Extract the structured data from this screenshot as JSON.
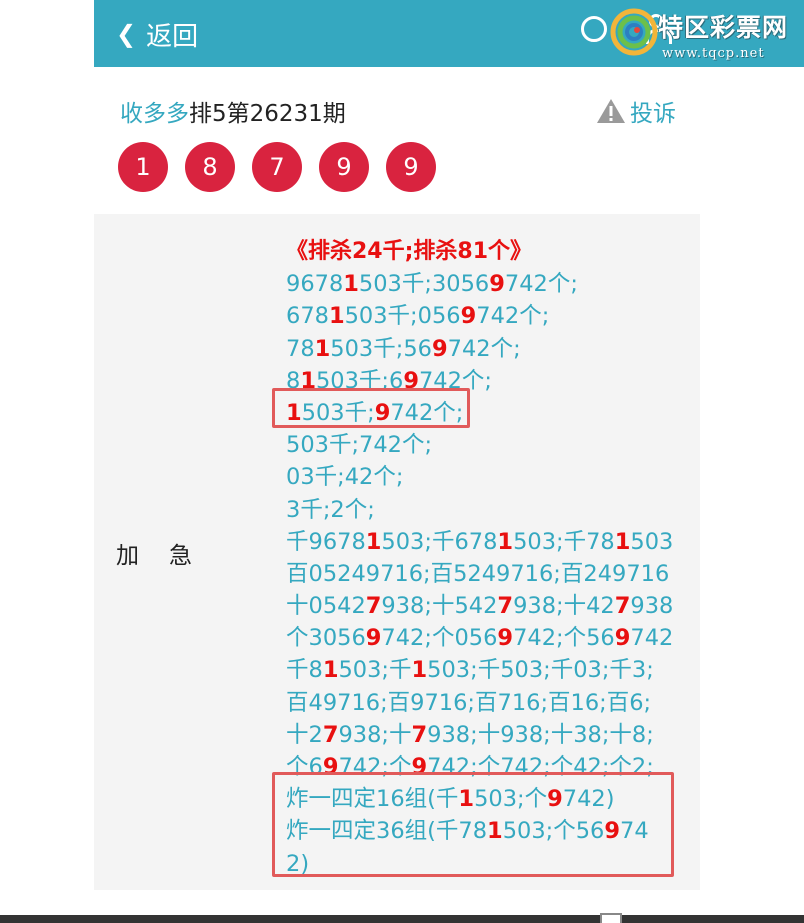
{
  "header": {
    "back_label": "返回",
    "watermark_title": "特区彩票网",
    "watermark_url": "www.tqcp.net",
    "bg_color": "#35a8c0"
  },
  "title": {
    "author": "收多多",
    "issue": "排5第26231期",
    "complain_label": "投诉"
  },
  "balls": [
    "1",
    "8",
    "7",
    "9",
    "9"
  ],
  "panel": {
    "label": "加急",
    "lines": [
      [
        {
          "t": "《排杀24千;排杀81个》",
          "r": true
        }
      ],
      [
        {
          "t": "9678"
        },
        {
          "t": "1",
          "r": true
        },
        {
          "t": "503千;3056"
        },
        {
          "t": "9",
          "r": true
        },
        {
          "t": "742个;"
        }
      ],
      [
        {
          "t": "678"
        },
        {
          "t": "1",
          "r": true
        },
        {
          "t": "503千;056"
        },
        {
          "t": "9",
          "r": true
        },
        {
          "t": "742个;"
        }
      ],
      [
        {
          "t": "78"
        },
        {
          "t": "1",
          "r": true
        },
        {
          "t": "503千;56"
        },
        {
          "t": "9",
          "r": true
        },
        {
          "t": "742个;"
        }
      ],
      [
        {
          "t": "8"
        },
        {
          "t": "1",
          "r": true
        },
        {
          "t": "503千;6"
        },
        {
          "t": "9",
          "r": true
        },
        {
          "t": "742个;"
        }
      ],
      [
        {
          "t": "1",
          "r": true
        },
        {
          "t": "503千;"
        },
        {
          "t": "9",
          "r": true
        },
        {
          "t": "742个;"
        }
      ],
      [
        {
          "t": "503千;742个;"
        }
      ],
      [
        {
          "t": "03千;42个;"
        }
      ],
      [
        {
          "t": "3千;2个;"
        }
      ],
      [
        {
          "t": "千9678"
        },
        {
          "t": "1",
          "r": true
        },
        {
          "t": "503;千678"
        },
        {
          "t": "1",
          "r": true
        },
        {
          "t": "503;千78"
        },
        {
          "t": "1",
          "r": true
        },
        {
          "t": "503"
        }
      ],
      [
        {
          "t": "百05249716;百5249716;百249716"
        }
      ],
      [
        {
          "t": "十0542"
        },
        {
          "t": "7",
          "r": true
        },
        {
          "t": "938;十542"
        },
        {
          "t": "7",
          "r": true
        },
        {
          "t": "938;十42"
        },
        {
          "t": "7",
          "r": true
        },
        {
          "t": "938"
        }
      ],
      [
        {
          "t": "个3056"
        },
        {
          "t": "9",
          "r": true
        },
        {
          "t": "742;个056"
        },
        {
          "t": "9",
          "r": true
        },
        {
          "t": "742;个56"
        },
        {
          "t": "9",
          "r": true
        },
        {
          "t": "742"
        }
      ],
      [
        {
          "t": "千8"
        },
        {
          "t": "1",
          "r": true
        },
        {
          "t": "503;千"
        },
        {
          "t": "1",
          "r": true
        },
        {
          "t": "503;千503;千03;千3;"
        }
      ],
      [
        {
          "t": "百49716;百9716;百716;百16;百6;"
        }
      ],
      [
        {
          "t": "十2"
        },
        {
          "t": "7",
          "r": true
        },
        {
          "t": "938;十"
        },
        {
          "t": "7",
          "r": true
        },
        {
          "t": "938;十938;十38;十8;"
        }
      ],
      [
        {
          "t": "个6"
        },
        {
          "t": "9",
          "r": true
        },
        {
          "t": "742;个"
        },
        {
          "t": "9",
          "r": true
        },
        {
          "t": "742;个742;个42;个2;"
        }
      ],
      [
        {
          "t": "炸一四定16组(千"
        },
        {
          "t": "1",
          "r": true
        },
        {
          "t": "503;个"
        },
        {
          "t": "9",
          "r": true
        },
        {
          "t": "742)"
        }
      ],
      [
        {
          "t": "炸一四定36组(千78"
        },
        {
          "t": "1",
          "r": true
        },
        {
          "t": "503;个56"
        },
        {
          "t": "9",
          "r": true
        },
        {
          "t": "74"
        }
      ],
      [
        {
          "t": "2)"
        }
      ]
    ]
  }
}
